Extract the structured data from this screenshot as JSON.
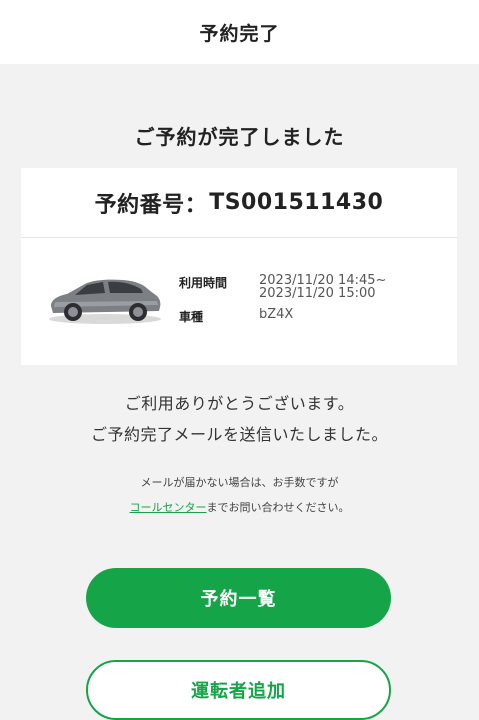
{
  "header": {
    "title": "予約完了"
  },
  "heading": "ご予約が完了しました",
  "reservation": {
    "number_label": "予約番号：",
    "number": "TS001511430",
    "usage_time_label": "利用時間",
    "usage_time_start": "2023/11/20 14:45~",
    "usage_time_end": "2023/11/20 15:00",
    "car_type_label": "車種",
    "car_type": "bZ4X"
  },
  "thanks": {
    "line1": "ご利用ありがとうございます。",
    "line2": "ご予約完了メールを送信いたしました。"
  },
  "note": {
    "line1": "メールが届かない場合は、お手数ですが",
    "link": "コールセンター",
    "line2_rest": "までお問い合わせください。"
  },
  "buttons": {
    "reservation_list": "予約一覧",
    "add_driver": "運転者追加"
  },
  "colors": {
    "accent": "#15a548",
    "background": "#f2f2f2"
  }
}
